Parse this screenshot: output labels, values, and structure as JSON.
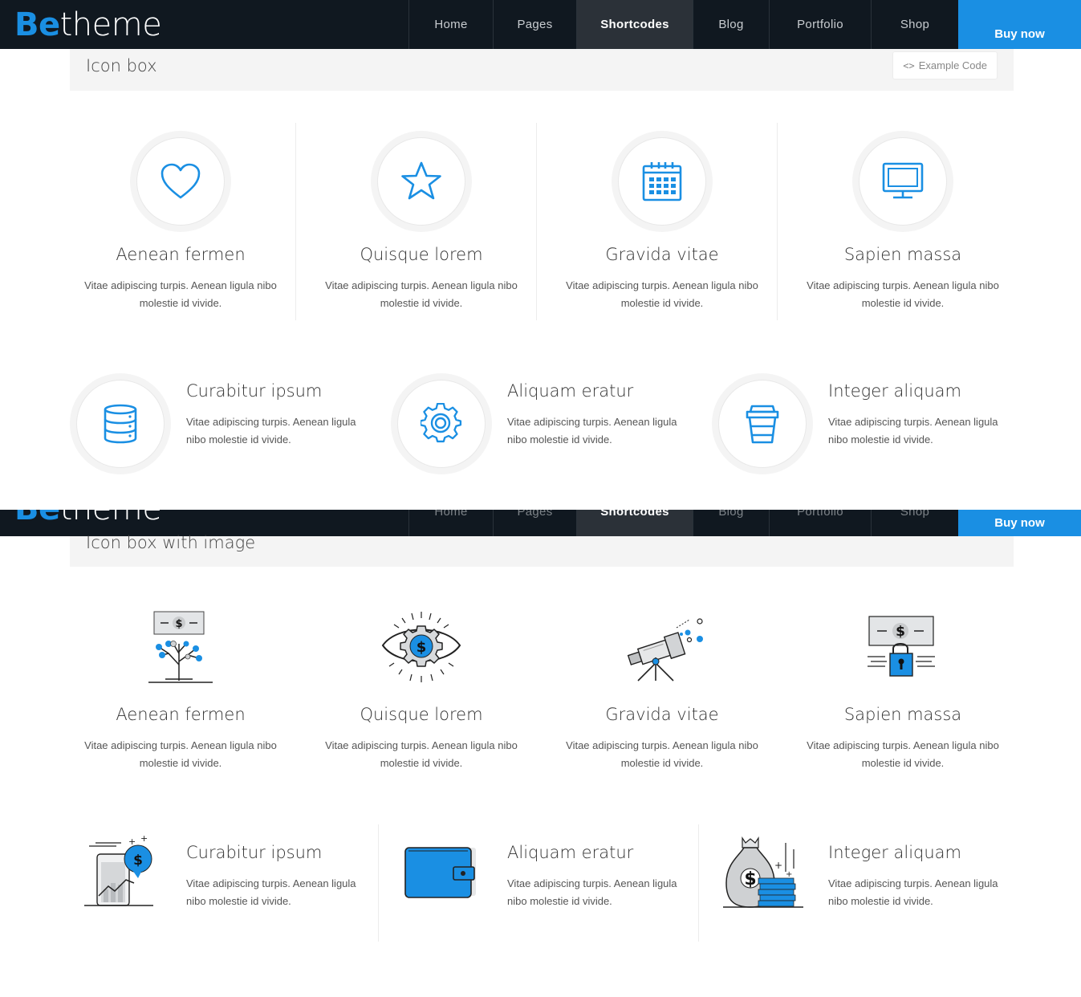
{
  "brand": {
    "logo_be": "Be",
    "logo_rest": "theme"
  },
  "nav": {
    "items": [
      {
        "label": "Home"
      },
      {
        "label": "Pages"
      },
      {
        "label": "Shortcodes",
        "active": true
      },
      {
        "label": "Blog"
      },
      {
        "label": "Portfolio"
      },
      {
        "label": "Shop"
      }
    ],
    "buy_label": "Buy now"
  },
  "section_icon_box": {
    "title": "Icon box",
    "example_code_label": "Example Code",
    "top_items": [
      {
        "icon": "heart-icon",
        "title": "Aenean fermen",
        "text": "Vitae adipiscing turpis. Aenean ligula nibo molestie id vivide."
      },
      {
        "icon": "star-icon",
        "title": "Quisque lorem",
        "text": "Vitae adipiscing turpis. Aenean ligula nibo molestie id vivide."
      },
      {
        "icon": "calendar-icon",
        "title": "Gravida vitae",
        "text": "Vitae adipiscing turpis. Aenean ligula nibo molestie id vivide."
      },
      {
        "icon": "monitor-icon",
        "title": "Sapien massa",
        "text": "Vitae adipiscing turpis. Aenean ligula nibo molestie id vivide."
      }
    ],
    "bottom_items": [
      {
        "icon": "database-icon",
        "title": "Curabitur ipsum",
        "text": "Vitae adipiscing turpis. Aenean ligula nibo molestie id vivide."
      },
      {
        "icon": "gear-icon",
        "title": "Aliquam eratur",
        "text": "Vitae adipiscing turpis. Aenean ligula nibo molestie id vivide."
      },
      {
        "icon": "coffee-cup-icon",
        "title": "Integer aliquam",
        "text": "Vitae adipiscing turpis. Aenean ligula nibo molestie id vivide."
      }
    ]
  },
  "section_icon_box_image": {
    "title": "Icon box with image",
    "top_items": [
      {
        "icon": "money-tree-icon",
        "title": "Aenean fermen",
        "text": "Vitae adipiscing turpis. Aenean ligula nibo molestie id vivide."
      },
      {
        "icon": "money-eye-gear-icon",
        "title": "Quisque lorem",
        "text": "Vitae adipiscing turpis. Aenean ligula nibo molestie id vivide."
      },
      {
        "icon": "telescope-icon",
        "title": "Gravida vitae",
        "text": "Vitae adipiscing turpis. Aenean ligula nibo molestie id vivide."
      },
      {
        "icon": "money-lock-icon",
        "title": "Sapien massa",
        "text": "Vitae adipiscing turpis. Aenean ligula nibo molestie id vivide."
      }
    ],
    "bottom_items": [
      {
        "icon": "mobile-growth-chart-icon",
        "title": "Curabitur ipsum",
        "text": "Vitae adipiscing turpis. Aenean ligula nibo molestie id vivide."
      },
      {
        "icon": "wallet-icon",
        "title": "Aliquam eratur",
        "text": "Vitae adipiscing turpis. Aenean ligula nibo molestie id vivide."
      },
      {
        "icon": "money-bag-coins-icon",
        "title": "Integer aliquam",
        "text": "Vitae adipiscing turpis. Aenean ligula nibo molestie id vivide."
      }
    ],
    "dollar_sign": "$"
  },
  "colors": {
    "accent": "#1a8fe3",
    "header_bg": "#101820",
    "section_bg": "#f4f4f4"
  }
}
